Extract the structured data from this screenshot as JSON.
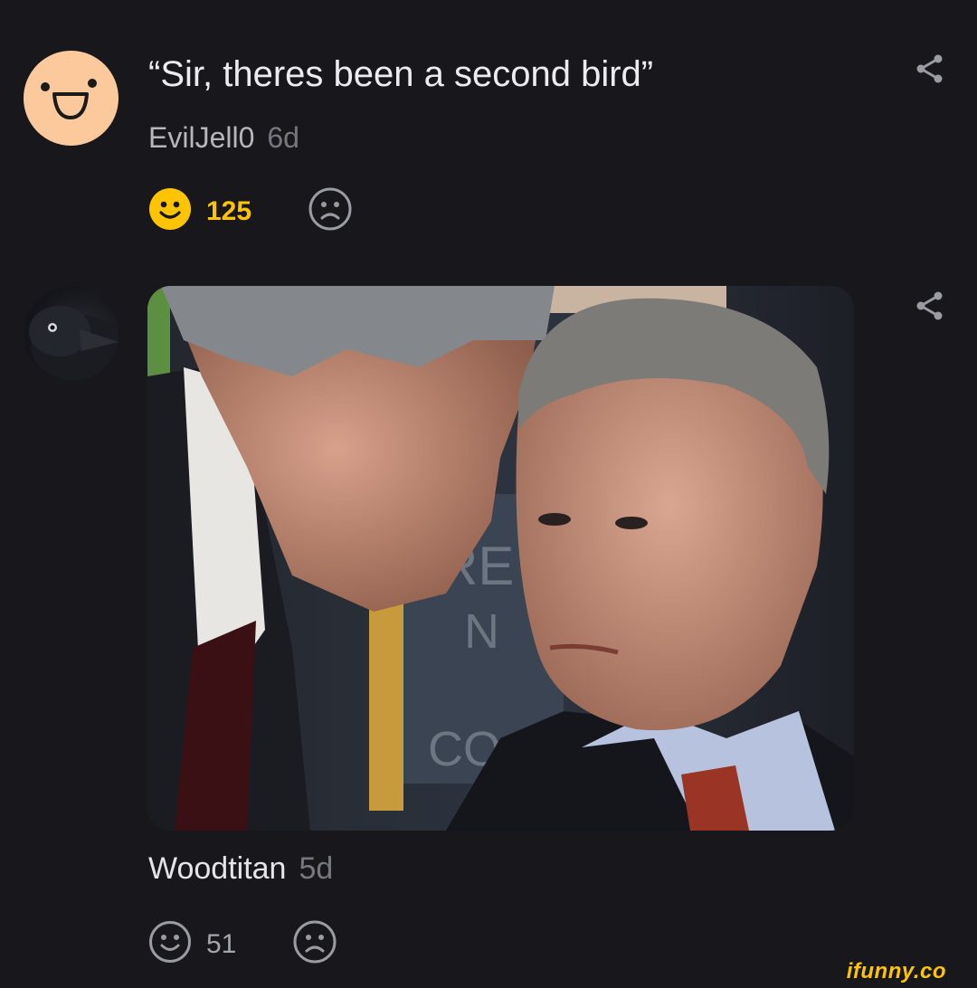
{
  "comments": [
    {
      "text": "“Sir, theres been a second bird”",
      "author": "EvilJell0",
      "age": "6d",
      "smiles": "125",
      "avatar_icon": "smiley-face-avatar-icon"
    },
    {
      "author": "Woodtitan",
      "age": "5d",
      "smiles": "51",
      "image_description_icon": "photo-attachment",
      "avatar_icon": "crow-avatar-icon",
      "image_text": [
        "RE",
        "N",
        "CO"
      ]
    }
  ],
  "watermark": "ifunny.co",
  "colors": {
    "background": "#17171c",
    "accent": "#ffc400",
    "avatar_peach": "#fbc99c"
  },
  "icons": {
    "share": "share-icon",
    "smile": "smile-icon",
    "unsmile": "frown-icon"
  }
}
